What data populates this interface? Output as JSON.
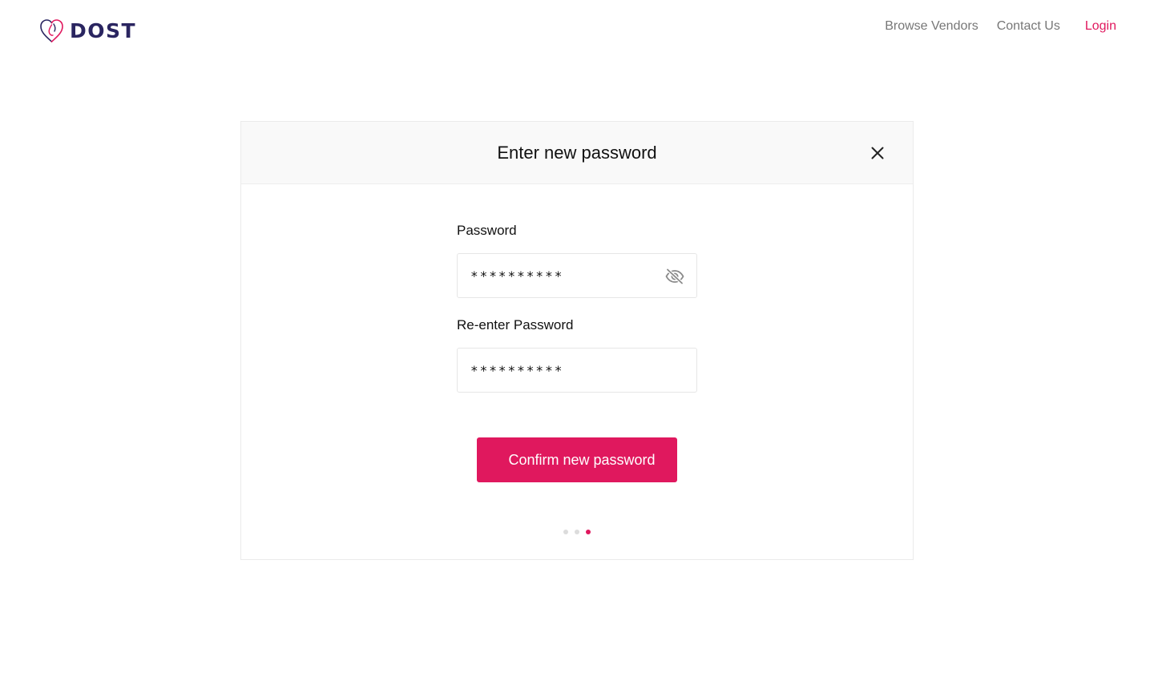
{
  "brand": {
    "name": "DOST",
    "logo_icon": "heart-hands-icon",
    "text_color": "#2a2560",
    "accent_color": "#e0185e"
  },
  "nav": {
    "items": [
      {
        "label": "Browse Vendors"
      },
      {
        "label": "Contact Us"
      }
    ],
    "login_label": "Login"
  },
  "dialog": {
    "title": "Enter new password",
    "close_icon": "close-icon",
    "password": {
      "label": "Password",
      "value": "**********",
      "visibility_icon": "eye-off-icon"
    },
    "confirm_password": {
      "label": "Re-enter Password",
      "value": "**********"
    },
    "submit_label": "Confirm new password",
    "steps": {
      "total": 3,
      "current": 3
    }
  }
}
